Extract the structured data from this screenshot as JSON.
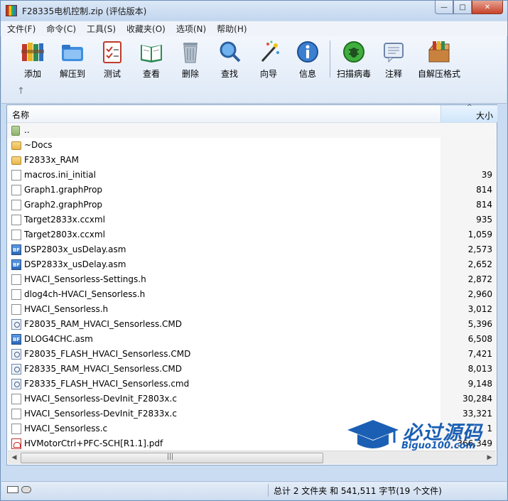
{
  "window": {
    "title": "F28335电机控制.zip (评估版本)",
    "buttons": {
      "minimize": "—",
      "maximize": "□",
      "close": "✕"
    }
  },
  "menu": [
    "文件(F)",
    "命令(C)",
    "工具(S)",
    "收藏夹(O)",
    "选项(N)",
    "帮助(H)"
  ],
  "toolbar": {
    "add": "添加",
    "extract": "解压到",
    "test": "测试",
    "view": "查看",
    "delete": "删除",
    "find": "查找",
    "wizard": "向导",
    "info": "信息",
    "scan": "扫描病毒",
    "comment": "注释",
    "sfx": "自解压格式",
    "up": "↑"
  },
  "columns": {
    "name": "名称",
    "size": "大小"
  },
  "files": [
    {
      "name": "..",
      "size": "",
      "type": "up"
    },
    {
      "name": "~Docs",
      "size": "",
      "type": "folder"
    },
    {
      "name": "F2833x_RAM",
      "size": "",
      "type": "folder"
    },
    {
      "name": "macros.ini_initial",
      "size": "39",
      "type": "file"
    },
    {
      "name": "Graph1.graphProp",
      "size": "814",
      "type": "file"
    },
    {
      "name": "Graph2.graphProp",
      "size": "814",
      "type": "file"
    },
    {
      "name": "Target2833x.ccxml",
      "size": "935",
      "type": "file"
    },
    {
      "name": "Target2803x.ccxml",
      "size": "1,059",
      "type": "file"
    },
    {
      "name": "DSP2803x_usDelay.asm",
      "size": "2,573",
      "type": "asm"
    },
    {
      "name": "DSP2833x_usDelay.asm",
      "size": "2,652",
      "type": "asm"
    },
    {
      "name": "HVACI_Sensorless-Settings.h",
      "size": "2,872",
      "type": "file"
    },
    {
      "name": "dlog4ch-HVACI_Sensorless.h",
      "size": "2,960",
      "type": "file"
    },
    {
      "name": "HVACI_Sensorless.h",
      "size": "3,012",
      "type": "file"
    },
    {
      "name": "F28035_RAM_HVACI_Sensorless.CMD",
      "size": "5,396",
      "type": "cmd"
    },
    {
      "name": "DLOG4CHC.asm",
      "size": "6,508",
      "type": "asm"
    },
    {
      "name": "F28035_FLASH_HVACI_Sensorless.CMD",
      "size": "7,421",
      "type": "cmd"
    },
    {
      "name": "F28335_RAM_HVACI_Sensorless.CMD",
      "size": "8,013",
      "type": "cmd"
    },
    {
      "name": "F28335_FLASH_HVACI_Sensorless.cmd",
      "size": "9,148",
      "type": "cmd"
    },
    {
      "name": "HVACI_Sensorless-DevInit_F2803x.c",
      "size": "30,284",
      "type": "file"
    },
    {
      "name": "HVACI_Sensorless-DevInit_F2833x.c",
      "size": "33,321",
      "type": "file"
    },
    {
      "name": "HVACI_Sensorless.c",
      "size": "1",
      "type": "file"
    },
    {
      "name": "HVMotorCtrl+PFC-SCH[R1.1].pdf",
      "size": "366,349",
      "type": "pdf"
    }
  ],
  "status": {
    "summary": "总计 2 文件夹 和 541,511 字节(19 个文件)"
  },
  "watermark": {
    "brand": "必过源码",
    "site": "Biguo100.com"
  }
}
